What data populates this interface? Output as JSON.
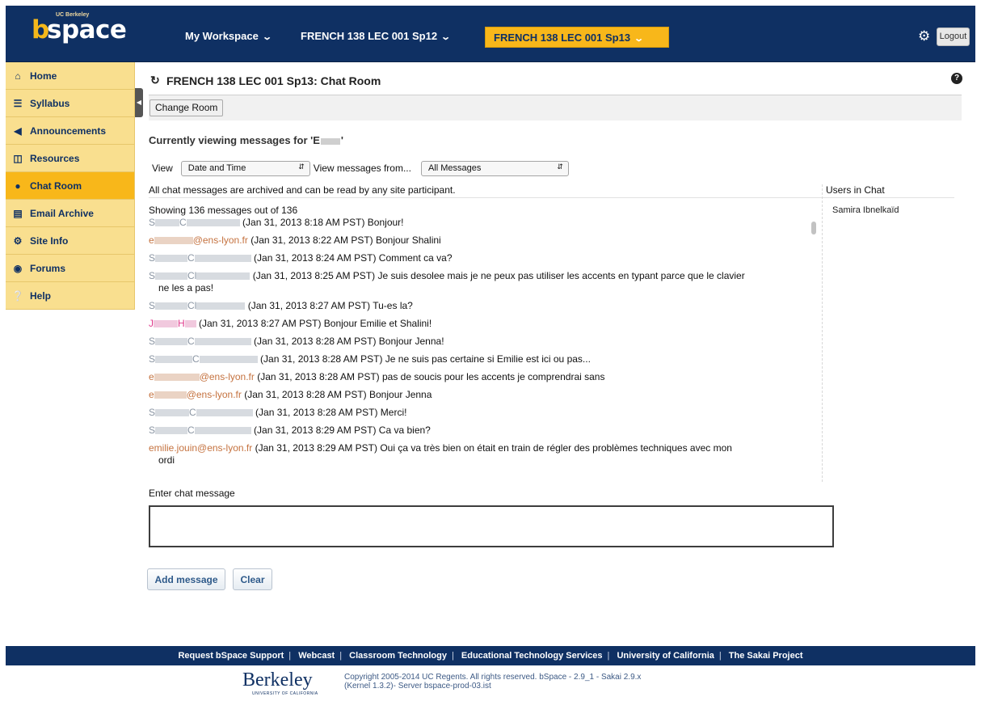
{
  "header": {
    "logo_small": "UC Berkeley",
    "logo_b": "b",
    "logo_space": "space",
    "workspace": "My Workspace",
    "site_prev": "FRENCH 138 LEC 001 Sp12",
    "site_current": "FRENCH 138 LEC 001 Sp13",
    "logout": "Logout"
  },
  "sidebar": {
    "items": [
      {
        "label": "Home",
        "icon": "home-icon"
      },
      {
        "label": "Syllabus",
        "icon": "list-icon"
      },
      {
        "label": "Announcements",
        "icon": "megaphone-icon"
      },
      {
        "label": "Resources",
        "icon": "folder-icon"
      },
      {
        "label": "Chat Room",
        "icon": "chat-bubble-icon",
        "active": true
      },
      {
        "label": "Email Archive",
        "icon": "inbox-icon"
      },
      {
        "label": "Site Info",
        "icon": "gears-icon"
      },
      {
        "label": "Forums",
        "icon": "comments-icon"
      },
      {
        "label": "Help",
        "icon": "question-icon"
      }
    ]
  },
  "main": {
    "title": "FRENCH 138 LEC 001 Sp13: Chat Room",
    "change_room": "Change Room",
    "viewing_prefix": "Currently viewing messages for 'E",
    "viewing_suffix": "'",
    "view_label": "View",
    "view_select": "Date and Time",
    "view_from_label": "View messages from...",
    "from_select": "All Messages",
    "archive_note": "All chat messages are archived and can be read by any site participant.",
    "users_header": "Users in Chat",
    "users": [
      "Samira Ibnelkaïd"
    ],
    "showing": "Showing 136 messages out of 136",
    "messages": [
      {
        "who": "S",
        "who2": "C",
        "time": "(Jan 31, 2013 8:18 AM PST)",
        "text": "Bonjour!",
        "style": "gray"
      },
      {
        "who": "e",
        "who2": "@ens-lyon.fr",
        "time": "(Jan 31, 2013 8:22 AM PST)",
        "text": "Bonjour Shalini",
        "style": "orange"
      },
      {
        "who": "S",
        "who2": "C",
        "time": "(Jan 31, 2013 8:24 AM PST)",
        "text": "Comment ca va?",
        "style": "gray"
      },
      {
        "who": "S",
        "who2": "Cl",
        "time": "(Jan 31, 2013 8:25 AM PST)",
        "text": "Je suis desolee mais je ne peux pas utiliser les accents en typant parce que le clavier",
        "cont": "ne les a pas!",
        "style": "gray"
      },
      {
        "who": "S",
        "who2": "Cl",
        "time": "(Jan 31, 2013 8:27 AM PST)",
        "text": "Tu-es la?",
        "style": "gray"
      },
      {
        "who": "J",
        "who2": "H",
        "time": "(Jan 31, 2013 8:27 AM PST)",
        "text": "Bonjour Emilie et Shalini!",
        "style": "pink"
      },
      {
        "who": "S",
        "who2": "C",
        "time": "(Jan 31, 2013 8:28 AM PST)",
        "text": "Bonjour Jenna!",
        "style": "gray"
      },
      {
        "who": "S",
        "who2": "C",
        "time": "(Jan 31, 2013 8:28 AM PST)",
        "text": "Je ne suis pas certaine si Emilie est ici ou pas...",
        "style": "gray"
      },
      {
        "who": "e",
        "who2": "@ens-lyon.fr",
        "time": "(Jan 31, 2013 8:28 AM PST)",
        "text": "pas de soucis pour les accents je comprendrai sans",
        "style": "orange"
      },
      {
        "who": "e",
        "who2": "@ens-lyon.fr",
        "time": "(Jan 31, 2013 8:28 AM PST)",
        "text": "Bonjour Jenna",
        "style": "orange"
      },
      {
        "who": "S",
        "who2": "C",
        "time": "(Jan 31, 2013 8:28 AM PST)",
        "text": "Merci!",
        "style": "gray"
      },
      {
        "who": "S",
        "who2": "C",
        "time": "(Jan 31, 2013 8:29 AM PST)",
        "text": "Ca va bien?",
        "style": "gray"
      },
      {
        "who": "emilie.jouin@ens-lyon.fr",
        "who2": "",
        "time": "(Jan 31, 2013 8:29 AM PST)",
        "text": "Oui ça va très bien on était en train de régler des problèmes techniques avec mon",
        "cont": "ordi",
        "style": "orange"
      }
    ],
    "enter_label": "Enter chat message",
    "add_message": "Add message",
    "clear": "Clear"
  },
  "footer": {
    "links": [
      "Request bSpace Support",
      "Webcast",
      "Classroom Technology",
      "Educational Technology Services",
      "University of California",
      "The Sakai Project"
    ],
    "berkeley": "Berkeley",
    "berkeley_tag": "UNIVERSITY OF CALIFORNIA",
    "copyright_1": "Copyright 2005-2014 UC Regents. All rights reserved. bSpace - 2.9_1 - Sakai 2.9.x",
    "copyright_2": "(Kernel 1.3.2)- Server bspace-prod-03.ist"
  },
  "colors": {
    "navy": "#0f3063",
    "gold": "#f8b71a",
    "nav_bg": "#f9df8f"
  }
}
